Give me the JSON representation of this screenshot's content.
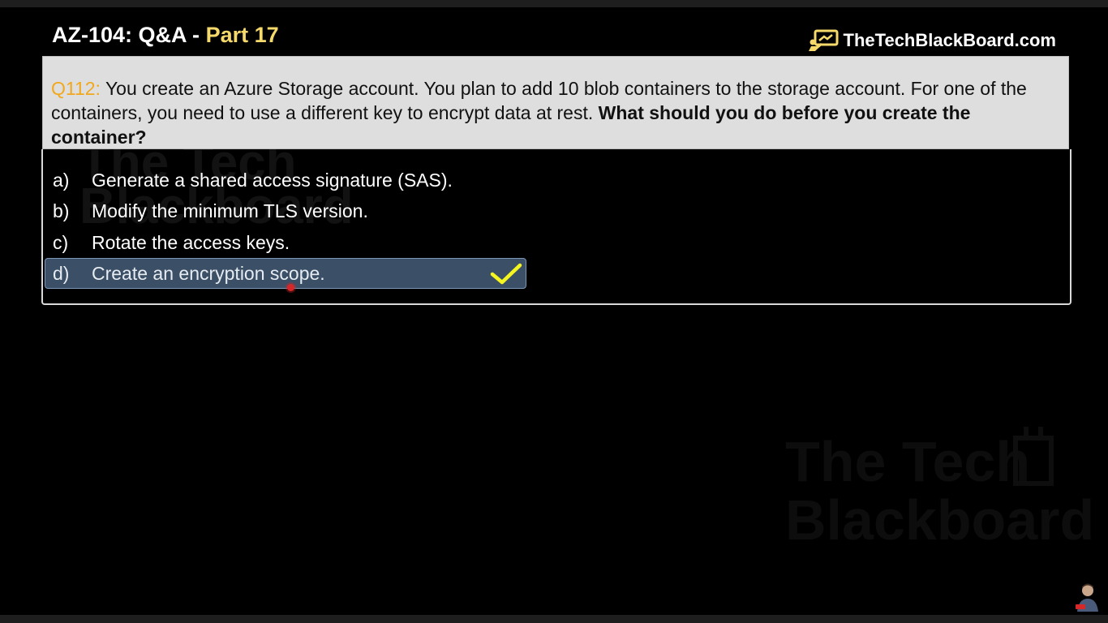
{
  "header": {
    "title": "AZ-104: Q&A",
    "separator": "-",
    "part": "Part 17",
    "brand": "TheTechBlackBoard.com",
    "brand_icon": "chalkboard-icon"
  },
  "question": {
    "number": "Q112:",
    "text": "You create an Azure Storage account. You plan to add 10 blob containers to the storage account. For one of the containers, you need to use a different key to encrypt data at rest.",
    "emphasis": "What should you do before you create the container?"
  },
  "options": [
    {
      "letter": "a)",
      "text": "Generate a shared access signature (SAS)."
    },
    {
      "letter": "b)",
      "text": "Modify the minimum TLS version."
    },
    {
      "letter": "c)",
      "text": "Rotate the access keys."
    },
    {
      "letter": "d)",
      "text": "Create an encryption scope."
    }
  ],
  "correct_option": "d)",
  "watermark": {
    "line1": "The Tech",
    "line2": "Blackboard"
  },
  "colors": {
    "accent_yellow": "#f6d96b",
    "question_number": "#f2a81d",
    "check_mark": "#f5f51f",
    "selected_bg": "#3b4f66"
  }
}
